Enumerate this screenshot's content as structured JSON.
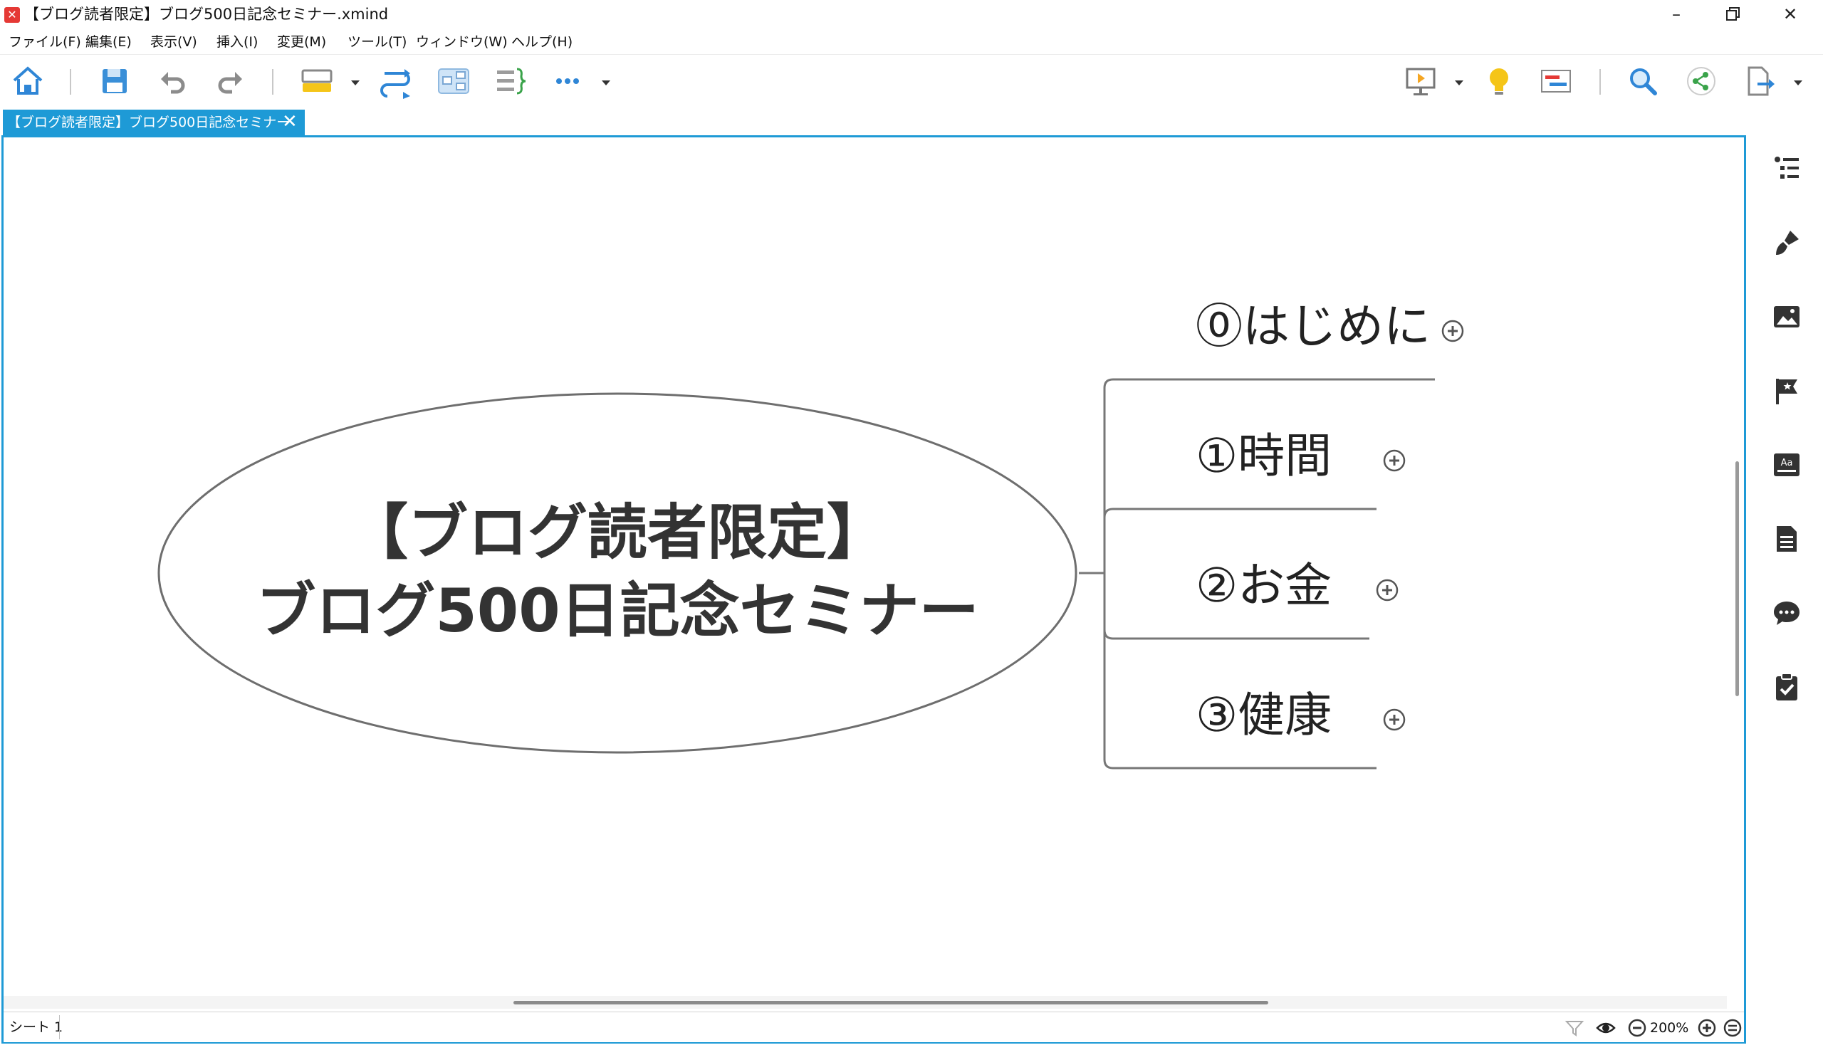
{
  "window": {
    "title": "【ブログ読者限定】ブログ500日記念セミナー.xmind",
    "app_icon": "xmind-logo-icon"
  },
  "menu": [
    "ファイル(F)",
    "編集(E)",
    "表示(V)",
    "挿入(I)",
    "変更(M)",
    "ツール(T)",
    "ウィンドウ(W)",
    "ヘルプ(H)"
  ],
  "tab": {
    "label": "【ブログ読者限定】ブログ500日記念セミナー"
  },
  "mindmap": {
    "central": {
      "line1": "【ブログ読者限定】",
      "line2": "ブログ500日記念セミナー"
    },
    "topics": [
      {
        "label": "⓪はじめに"
      },
      {
        "label": "①時間"
      },
      {
        "label": "②お金"
      },
      {
        "label": "③健康"
      }
    ]
  },
  "status": {
    "sheet": "シート 1",
    "zoom": "200%"
  },
  "colors": {
    "accent": "#1e9ad6",
    "central_text": "#333333",
    "connector": "#777777",
    "toolbar_icon": "#3a8fd8"
  }
}
